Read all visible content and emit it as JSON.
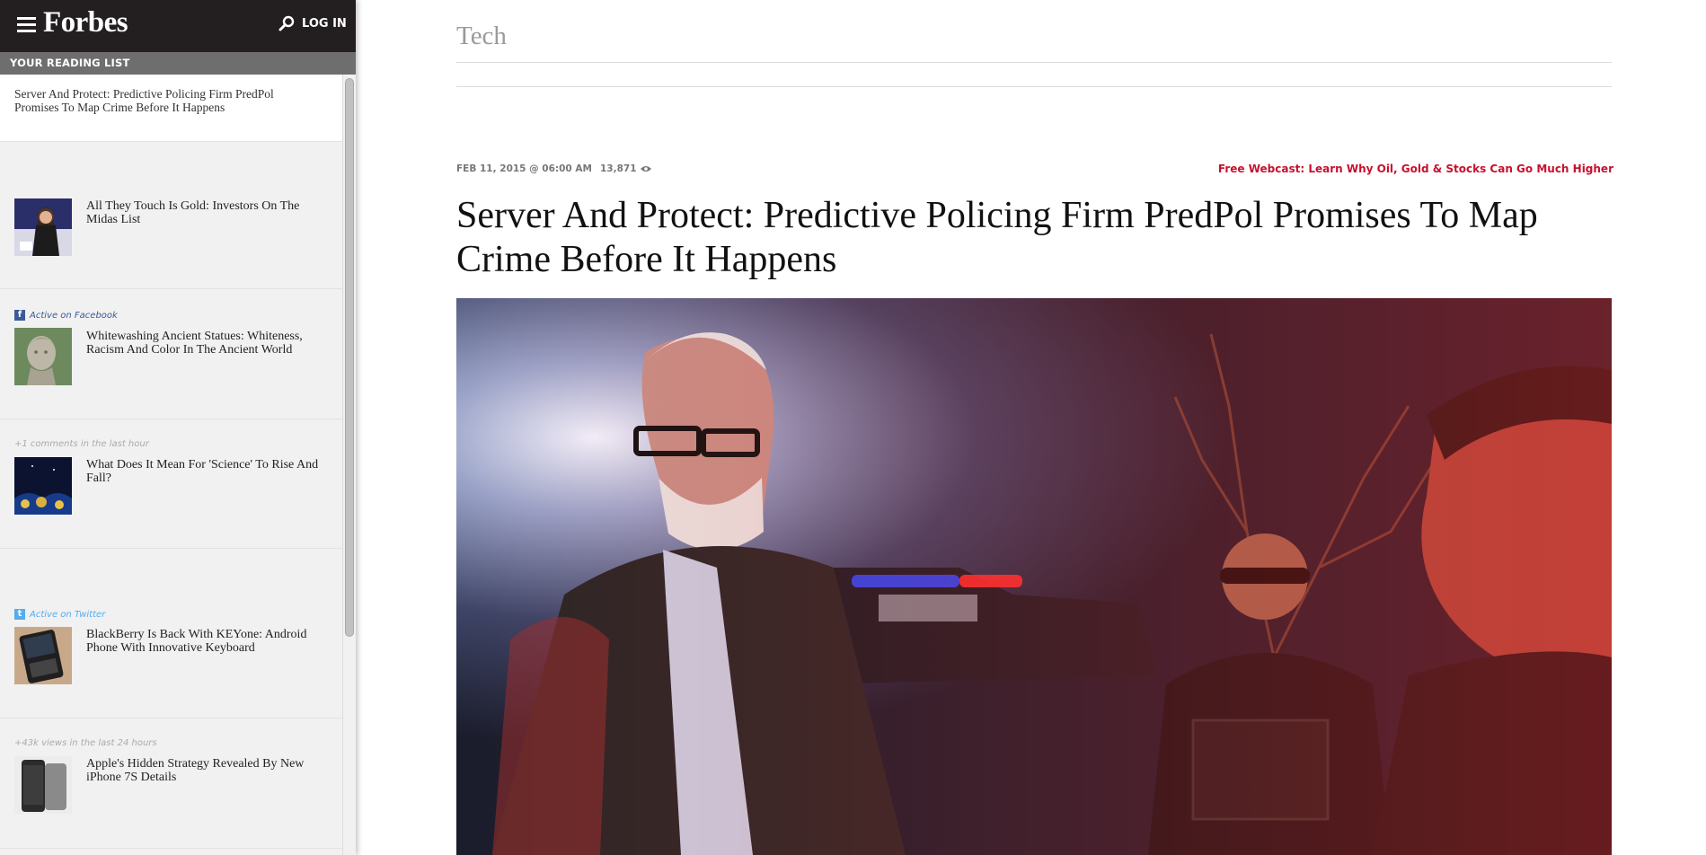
{
  "header": {
    "logo": "Forbes",
    "login_label": "LOG IN"
  },
  "reading_list": {
    "heading": "YOUR READING LIST",
    "current": "Server And Protect: Predictive Policing Firm PredPol Promises To Map Crime Before It Happens",
    "items": [
      {
        "meta": "",
        "title": "All They Touch Is Gold: Investors On The Midas List"
      },
      {
        "meta": "Active on Facebook",
        "meta_icon": "facebook-icon",
        "title": "Whitewashing Ancient Statues: Whiteness, Racism And Color In The Ancient World"
      },
      {
        "meta": "+1 comments in the last hour",
        "title": "What Does It Mean For 'Science' To Rise And Fall?"
      },
      {
        "meta": "Active on Twitter",
        "meta_icon": "twitter-icon",
        "title": "BlackBerry Is Back With KEYone: Android Phone With Innovative Keyboard"
      },
      {
        "meta": "+43k views in the last 24 hours",
        "title": "Apple's Hidden Strategy Revealed By New iPhone 7S Details"
      }
    ]
  },
  "article": {
    "section": "Tech",
    "date": "FEB 11, 2015 @ 06:00 AM",
    "views": "13,871",
    "promo": "Free Webcast: Learn Why Oil, Gold & Stocks Can Go Much Higher",
    "headline": "Server And Protect: Predictive Policing Firm PredPol Promises To Map Crime Before It Happens"
  },
  "colors": {
    "topbar": "#231f20",
    "promo_red": "#c8102e",
    "facebook_blue": "#3b5998",
    "twitter_blue": "#55acee"
  }
}
